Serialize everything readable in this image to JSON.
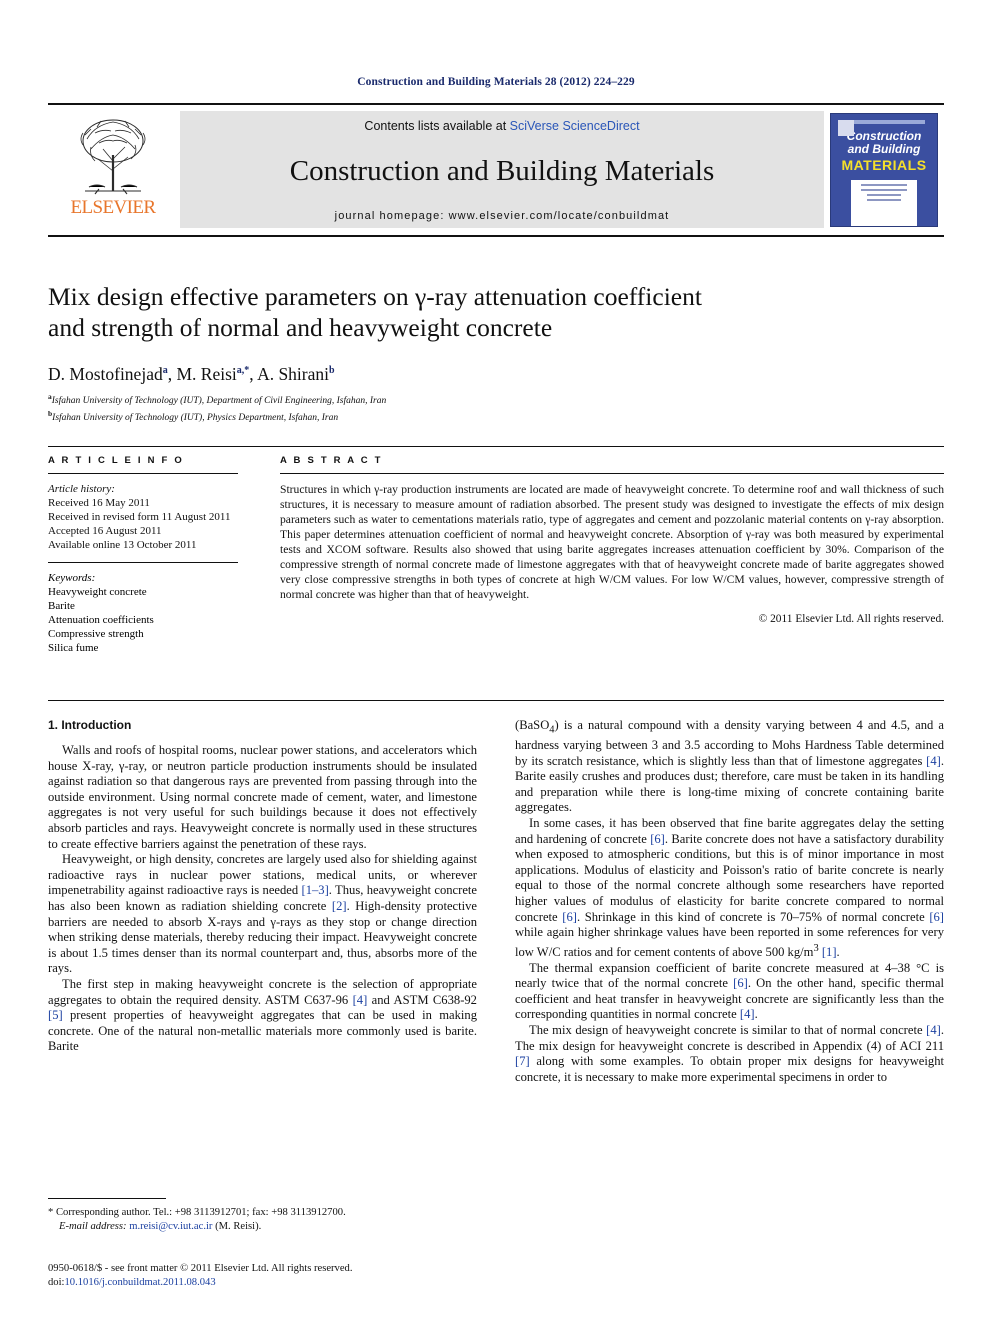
{
  "running_head": "Construction and Building Materials 28 (2012) 224–229",
  "masthead": {
    "contents_prefix": "Contents lists available at ",
    "sciencedirect": "SciVerse ScienceDirect",
    "journal_name": "Construction and Building Materials",
    "homepage_prefix": "journal homepage: ",
    "homepage_url": "www.elsevier.com/locate/conbuildmat",
    "publisher": "ELSEVIER",
    "cover": {
      "line1": "Construction",
      "line2": "and Building",
      "line3": "MATERIALS"
    }
  },
  "article": {
    "title_line1": "Mix design effective parameters on γ-ray attenuation coefficient",
    "title_line2": "and strength of normal and heavyweight concrete",
    "authors_plain": "D. Mostofinejad a, M. Reisi a,*, A. Shirani b",
    "authors": [
      {
        "name": "D. Mostofinejad",
        "mark": "a"
      },
      {
        "name": "M. Reisi",
        "mark": "a,*"
      },
      {
        "name": "A. Shirani",
        "mark": "b"
      }
    ],
    "affiliations": [
      {
        "mark": "a",
        "text": "Isfahan University of Technology (IUT), Department of Civil Engineering, Isfahan, Iran"
      },
      {
        "mark": "b",
        "text": "Isfahan University of Technology (IUT), Physics Department, Isfahan, Iran"
      }
    ]
  },
  "info": {
    "heading": "A R T I C L E   I N F O",
    "history_label": "Article history:",
    "history": [
      "Received 16 May 2011",
      "Received in revised form 11 August 2011",
      "Accepted 16 August 2011",
      "Available online 13 October 2011"
    ],
    "keywords_label": "Keywords:",
    "keywords": [
      "Heavyweight concrete",
      "Barite",
      "Attenuation coefficients",
      "Compressive strength",
      "Silica fume"
    ]
  },
  "abstract": {
    "heading": "A B S T R A C T",
    "text": "Structures in which γ-ray production instruments are located are made of heavyweight concrete. To determine roof and wall thickness of such structures, it is necessary to measure amount of radiation absorbed. The present study was designed to investigate the effects of mix design parameters such as water to cementations materials ratio, type of aggregates and cement and pozzolanic material contents on γ-ray absorption. This paper determines attenuation coefficient of normal and heavyweight concrete. Absorption of γ-ray was both measured by experimental tests and XCOM software. Results also showed that using barite aggregates increases attenuation coefficient by 30%. Comparison of the compressive strength of normal concrete made of limestone aggregates with that of heavyweight concrete made of barite aggregates showed very close compressive strengths in both types of concrete at high W/CM values. For low W/CM values, however, compressive strength of normal concrete was higher than that of heavyweight.",
    "copyright": "© 2011 Elsevier Ltd. All rights reserved."
  },
  "sections": {
    "intro_heading": "1. Introduction",
    "left_paragraphs": [
      "Walls and roofs of hospital rooms, nuclear power stations, and accelerators which house X-ray, γ-ray, or neutron particle production instruments should be insulated against radiation so that dangerous rays are prevented from passing through into the outside environment. Using normal concrete made of cement, water, and limestone aggregates is not very useful for such buildings because it does not effectively absorb particles and rays. Heavyweight concrete is normally used in these structures to create effective barriers against the penetration of these rays.",
      "Heavyweight, or high density, concretes are largely used also for shielding against radioactive rays in nuclear power stations, medical units, or wherever impenetrability against radioactive rays is needed [1–3]. Thus, heavyweight concrete has also been known as radiation shielding concrete [2]. High-density protective barriers are needed to absorb X-rays and γ-rays as they stop or change direction when striking dense materials, thereby reducing their impact. Heavyweight concrete is about 1.5 times denser than its normal counterpart and, thus, absorbs more of the rays.",
      "The first step in making heavyweight concrete is the selection of appropriate aggregates to obtain the required density. ASTM C637-96 [4] and ASTM C638-92 [5] present properties of heavyweight aggregates that can be used in making concrete. One of the natural non-metallic materials more commonly used is barite. Barite"
    ],
    "right_paragraphs": [
      "(BaSO4) is a natural compound with a density varying between 4 and 4.5, and a hardness varying between 3 and 3.5 according to Mohs Hardness Table determined by its scratch resistance, which is slightly less than that of limestone aggregates [4]. Barite easily crushes and produces dust; therefore, care must be taken in its handling and preparation while there is long-time mixing of concrete containing barite aggregates.",
      "In some cases, it has been observed that fine barite aggregates delay the setting and hardening of concrete [6]. Barite concrete does not have a satisfactory durability when exposed to atmospheric conditions, but this is of minor importance in most applications. Modulus of elasticity and Poisson's ratio of barite concrete is nearly equal to those of the normal concrete although some researchers have reported higher values of modulus of elasticity for barite concrete compared to normal concrete [6]. Shrinkage in this kind of concrete is 70–75% of normal concrete [6] while again higher shrinkage values have been reported in some references for very low W/C ratios and for cement contents of above 500 kg/m3 [1].",
      "The thermal expansion coefficient of barite concrete measured at 4–38 °C is nearly twice that of the normal concrete [6]. On the other hand, specific thermal coefficient and heat transfer in heavyweight concrete are significantly less than the corresponding quantities in normal concrete [4].",
      "The mix design of heavyweight concrete is similar to that of normal concrete [4]. The mix design for heavyweight concrete is described in Appendix (4) of ACI 211 [7] along with some examples. To obtain proper mix designs for heavyweight concrete, it is necessary to make more experimental specimens in order to"
    ]
  },
  "footnote": {
    "marker": "*",
    "corresponding": "Corresponding author. Tel.: +98 3113912701; fax: +98 3113912700.",
    "email_label": "E-mail address:",
    "email": "m.reisi@cv.iut.ac.ir",
    "email_suffix": "(M. Reisi)."
  },
  "footer": {
    "issn_line": "0950-0618/$ - see front matter © 2011 Elsevier Ltd. All rights reserved.",
    "doi_label": "doi:",
    "doi": "10.1016/j.conbuildmat.2011.08.043"
  },
  "colors": {
    "link": "#1a3fa0",
    "runhead": "#1a2a6c",
    "elsevier_orange": "#e8762c",
    "cover_blue": "#3b4fa0",
    "cover_yellow": "#f5e02a"
  }
}
